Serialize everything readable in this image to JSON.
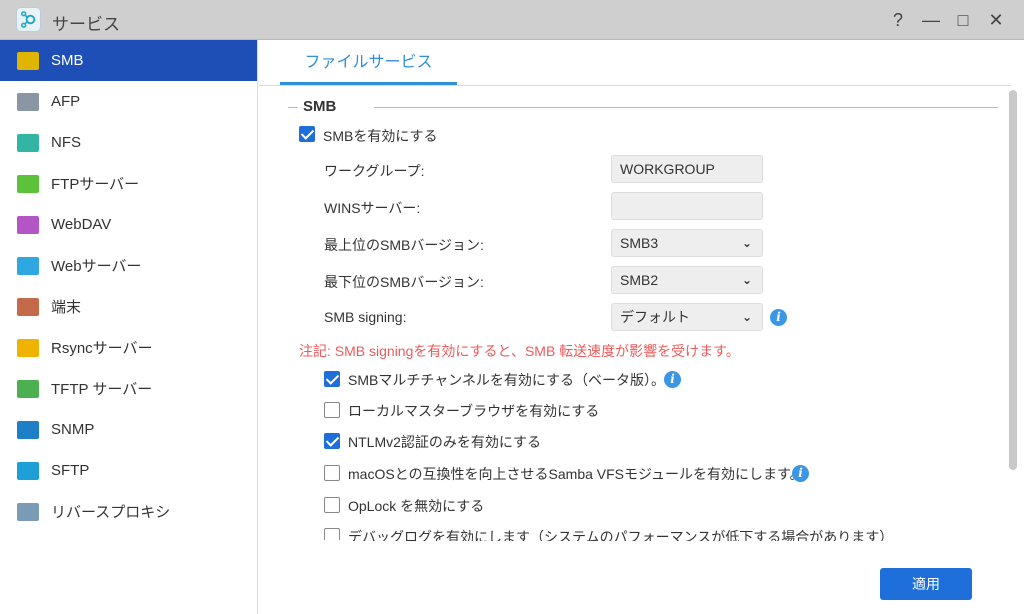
{
  "window": {
    "title": "サービス",
    "help": "?",
    "minimize": "—",
    "maximize": "□",
    "close": "✕"
  },
  "sidebar": {
    "items": [
      {
        "label": "SMB",
        "color": "#e0b400"
      },
      {
        "label": "AFP",
        "color": "#8a96a3"
      },
      {
        "label": "NFS",
        "color": "#33b5a5"
      },
      {
        "label": "FTPサーバー",
        "color": "#5cc23a"
      },
      {
        "label": "WebDAV",
        "color": "#b455c6"
      },
      {
        "label": "Webサーバー",
        "color": "#2fa7e0"
      },
      {
        "label": "端末",
        "color": "#c46a4a"
      },
      {
        "label": "Rsyncサーバー",
        "color": "#f0b400"
      },
      {
        "label": "TFTP サーバー",
        "color": "#4caf50"
      },
      {
        "label": "SNMP",
        "color": "#1e7fc6"
      },
      {
        "label": "SFTP",
        "color": "#1e9fd6"
      },
      {
        "label": "リバースプロキシ",
        "color": "#7a9bb5"
      }
    ]
  },
  "main": {
    "tab": "ファイルサービス",
    "section": "SMB",
    "enable_smb": {
      "label": "SMBを有効にする",
      "checked": true
    },
    "fields": [
      {
        "label": "ワークグループ:",
        "value": "WORKGROUP"
      },
      {
        "label": "WINSサーバー:",
        "value": ""
      },
      {
        "label": "最上位のSMBバージョン:",
        "value": "SMB3"
      },
      {
        "label": "最下位のSMBバージョン:",
        "value": "SMB2"
      },
      {
        "label": "SMB signing:",
        "value": "デフォルト"
      }
    ],
    "note": "注記: SMB signingを有効にすると、SMB 転送速度が影響を受けます。",
    "options": [
      {
        "label": "SMBマルチチャンネルを有効にする（ベータ版）。",
        "checked": true
      },
      {
        "label": "ローカルマスターブラウザを有効にする",
        "checked": false
      },
      {
        "label": "NTLMv2認証のみを有効にする",
        "checked": true
      },
      {
        "label": "macOSとの互換性を向上させるSamba VFSモジュールを有効にします。",
        "checked": false
      },
      {
        "label": "OpLock を無効にする",
        "checked": false
      },
      {
        "label": "デバッグログを有効にします（システムのパフォーマンスが低下する場合があります）",
        "checked": false
      }
    ],
    "apply": "適用"
  }
}
